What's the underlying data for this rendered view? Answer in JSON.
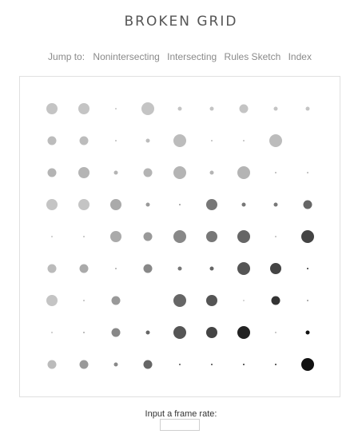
{
  "title": "BROKEN GRID",
  "nav": {
    "prefix": "Jump to:",
    "links": [
      "Nonintersecting",
      "Intersecting",
      "Rules Sketch",
      "Index"
    ]
  },
  "sketch": {
    "grid": {
      "rows": 9,
      "cols": 9,
      "dots": [
        [
          [
            "#c4c4c4",
            "L"
          ],
          [
            "#c4c4c4",
            "L"
          ],
          [
            "#c4c4c4",
            "xs"
          ],
          [
            "#c4c4c4",
            "xl"
          ],
          [
            "#c4c4c4",
            "s"
          ],
          [
            "#c4c4c4",
            "s"
          ],
          [
            "#c4c4c4",
            "m"
          ],
          [
            "#c4c4c4",
            "s"
          ],
          [
            "#c4c4c4",
            "s"
          ]
        ],
        [
          [
            "#bcbcbc",
            "m"
          ],
          [
            "#bcbcbc",
            "m"
          ],
          [
            "#bcbcbc",
            "xs"
          ],
          [
            "#bcbcbc",
            "s"
          ],
          [
            "#bcbcbc",
            "xl"
          ],
          [
            "#bcbcbc",
            "xs"
          ],
          [
            "#bcbcbc",
            "xs"
          ],
          [
            "#bcbcbc",
            "xl"
          ],
          null
        ],
        [
          [
            "#b4b4b4",
            "m"
          ],
          [
            "#b4b4b4",
            "L"
          ],
          [
            "#b4b4b4",
            "s"
          ],
          [
            "#b4b4b4",
            "m"
          ],
          [
            "#b4b4b4",
            "xl"
          ],
          [
            "#b4b4b4",
            "s"
          ],
          [
            "#b4b4b4",
            "xl"
          ],
          [
            "#b4b4b4",
            "xs"
          ],
          [
            "#b4b4b4",
            "xs"
          ]
        ],
        [
          [
            "#c4c4c4",
            "L"
          ],
          [
            "#c4c4c4",
            "L"
          ],
          [
            "#aaaaaa",
            "L"
          ],
          [
            "#999999",
            "s"
          ],
          [
            "#999999",
            "xs"
          ],
          [
            "#777777",
            "L"
          ],
          [
            "#777777",
            "s"
          ],
          [
            "#777777",
            "s"
          ],
          [
            "#666666",
            "m"
          ]
        ],
        [
          [
            "#c4c4c4",
            "xs"
          ],
          [
            "#bbbbbb",
            "xs"
          ],
          [
            "#aaaaaa",
            "L"
          ],
          [
            "#999999",
            "m"
          ],
          [
            "#888888",
            "xl"
          ],
          [
            "#777777",
            "L"
          ],
          [
            "#666666",
            "xl"
          ],
          [
            "#bbbbbb",
            "xs"
          ],
          [
            "#444444",
            "xl"
          ]
        ],
        [
          [
            "#bbbbbb",
            "m"
          ],
          [
            "#aaaaaa",
            "m"
          ],
          [
            "#aaaaaa",
            "xs"
          ],
          [
            "#888888",
            "m"
          ],
          [
            "#777777",
            "s"
          ],
          [
            "#666666",
            "s"
          ],
          [
            "#555555",
            "xl"
          ],
          [
            "#444444",
            "L"
          ],
          [
            "#333333",
            "xs"
          ]
        ],
        [
          [
            "#c4c4c4",
            "L"
          ],
          [
            "#bbbbbb",
            "xs"
          ],
          [
            "#999999",
            "m"
          ],
          null,
          [
            "#666666",
            "xl"
          ],
          [
            "#555555",
            "L"
          ],
          [
            "#cccccc",
            "xs"
          ],
          [
            "#333333",
            "m"
          ],
          [
            "#999999",
            "xs"
          ]
        ],
        [
          [
            "#c4c4c4",
            "xs"
          ],
          [
            "#aaaaaa",
            "xs"
          ],
          [
            "#888888",
            "m"
          ],
          [
            "#666666",
            "s"
          ],
          [
            "#555555",
            "xl"
          ],
          [
            "#444444",
            "L"
          ],
          [
            "#222222",
            "xl"
          ],
          [
            "#bbbbbb",
            "xs"
          ],
          [
            "#111111",
            "s"
          ]
        ],
        [
          [
            "#bbbbbb",
            "m"
          ],
          [
            "#999999",
            "m"
          ],
          [
            "#888888",
            "s"
          ],
          [
            "#666666",
            "m"
          ],
          [
            "#555555",
            "xs"
          ],
          [
            "#444444",
            "xs"
          ],
          [
            "#333333",
            "xs"
          ],
          [
            "#333333",
            "xs"
          ],
          [
            "#111111",
            "xl"
          ]
        ]
      ]
    }
  },
  "frame_rate": {
    "label": "Input a frame rate:",
    "value": ""
  }
}
